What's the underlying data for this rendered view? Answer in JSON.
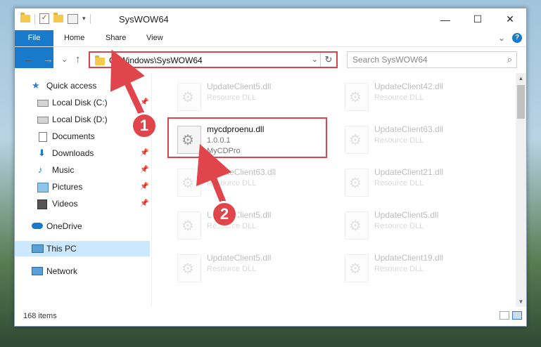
{
  "window": {
    "title": "SysWOW64",
    "minimize_glyph": "—",
    "maximize_glyph": "☐",
    "close_glyph": "✕"
  },
  "ribbon": {
    "tabs": [
      "File",
      "Home",
      "Share",
      "View"
    ],
    "expand_glyph": "⌄",
    "help_glyph": "?"
  },
  "navigation": {
    "back_glyph": "←",
    "forward_glyph": "→",
    "recent_glyph": "⌄",
    "up_glyph": "↑",
    "address": "C:\\Windows\\SysWOW64",
    "address_dropdown_glyph": "⌄",
    "refresh_glyph": "↻",
    "search_placeholder": "Search SysWOW64",
    "search_icon_glyph": "⌕"
  },
  "nav_pane": {
    "items": [
      {
        "label": "Quick access",
        "icon": "star-icon",
        "pinned": false
      },
      {
        "label": "Local Disk (C:)",
        "icon": "drive-icon",
        "pinned": true
      },
      {
        "label": "Local Disk (D:)",
        "icon": "drive-icon",
        "pinned": false
      },
      {
        "label": "Documents",
        "icon": "documents-icon",
        "pinned": false
      },
      {
        "label": "Downloads",
        "icon": "download-icon",
        "pinned": true
      },
      {
        "label": "Music",
        "icon": "music-icon",
        "pinned": true
      },
      {
        "label": "Pictures",
        "icon": "pictures-icon",
        "pinned": true
      },
      {
        "label": "Videos",
        "icon": "videos-icon",
        "pinned": true
      },
      {
        "label": "OneDrive",
        "icon": "cloud-icon",
        "pinned": false
      },
      {
        "label": "This PC",
        "icon": "computer-icon",
        "pinned": false,
        "selected": true
      },
      {
        "label": "Network",
        "icon": "network-icon",
        "pinned": false
      }
    ],
    "pin_glyph": "📌"
  },
  "files": [
    {
      "name": "UpdateClient5.dll",
      "type": "Resource DLL",
      "faded": true
    },
    {
      "name": "UpdateClient42.dll",
      "type": "Resource DLL",
      "faded": true
    },
    {
      "name": "mycdproenu.dll",
      "version": "1.0.0.1",
      "company": "MyCDPro",
      "faded": false
    },
    {
      "name": "UpdateClient63.dll",
      "type": "Resource DLL",
      "faded": true
    },
    {
      "name": "UpdateClient63.dll",
      "type": "Resource DLL",
      "faded": true
    },
    {
      "name": "UpdateClient21.dll",
      "type": "Resource DLL",
      "faded": true
    },
    {
      "name": "UpdateClient5.dll",
      "type": "Resource DLL",
      "faded": true
    },
    {
      "name": "UpdateClient5.dll",
      "type": "Resource DLL",
      "faded": true
    },
    {
      "name": "UpdateClient5.dll",
      "type": "Resource DLL",
      "faded": true
    },
    {
      "name": "UpdateClient19.dll",
      "type": "Resource DLL",
      "faded": true
    }
  ],
  "scrollbar": {
    "up_glyph": "▲",
    "down_glyph": "▼",
    "position": 0.0
  },
  "status": {
    "item_count": "168 items"
  },
  "callouts": {
    "step1": "1",
    "step2": "2"
  },
  "colors": {
    "accent": "#1979ca",
    "callout": "#e0454c",
    "selection": "#cce8ff"
  }
}
